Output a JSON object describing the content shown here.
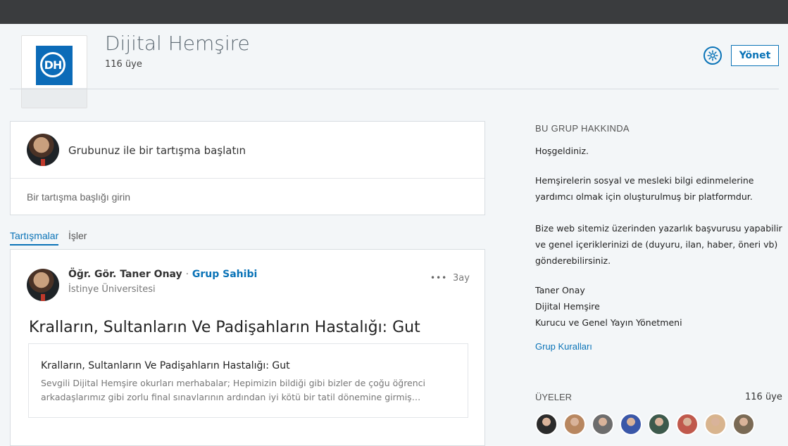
{
  "header": {
    "logo_text": "DH",
    "group_name": "Dijital Hemşire",
    "member_count": "116 üye",
    "manage_label": "Yönet"
  },
  "compose": {
    "prompt": "Grubunuz ile bir tartışma başlatın",
    "title_placeholder": "Bir tartışma başlığı girin"
  },
  "tabs": [
    {
      "label": "Tartışmalar",
      "active": true
    },
    {
      "label": "İşler",
      "active": false
    }
  ],
  "post": {
    "author": "Öğr. Gör. Taner Onay",
    "separator": "·",
    "role": "Grup Sahibi",
    "organization": "İstinye Üniversitesi",
    "menu": "•••",
    "age": "3ay",
    "headline": "Kralların, Sultanların Ve Padişahların Hastalığı: Gut",
    "preview_title": "Kralların, Sultanların Ve Padişahların Hastalığı: Gut",
    "preview_text": "Sevgili Dijital Hemşire okurları merhabalar; Hepimizin bildiği gibi bizler de çoğu öğrenci arkadaşlarımız gibi zorlu final sınavlarının ardından iyi kötü bir tatil dönemine girmiş…"
  },
  "about": {
    "heading": "BU GRUP HAKKINDA",
    "lines": [
      "Hoşgeldiniz.",
      "Hemşirelerin sosyal ve mesleki bilgi edinmelerine",
      "yardımcı olmak için oluşturulmuş bir platformdur.",
      "Bize web sitemiz üzerinden yazarlık başvurusu yapabilir",
      "ve genel içeriklerinizi de (duyuru, ilan, haber, öneri vb)",
      "gönderebilirsiniz.",
      "Taner Onay",
      "Dijital Hemşire",
      "Kurucu ve Genel Yayın Yönetmeni"
    ],
    "rules_link": "Grup Kuralları"
  },
  "members": {
    "heading": "ÜYELER",
    "count": "116 üye",
    "avatar_colors": [
      "#2b2b2b",
      "#b88760",
      "#6d6d6d",
      "#3a57a8",
      "#3d5a4c",
      "#c0594c",
      "#d8b48e",
      "#7a6a55"
    ]
  },
  "colors": {
    "accent": "#0a73b7",
    "topbar": "#3a3c3e",
    "logo": "#0b6bb8"
  }
}
